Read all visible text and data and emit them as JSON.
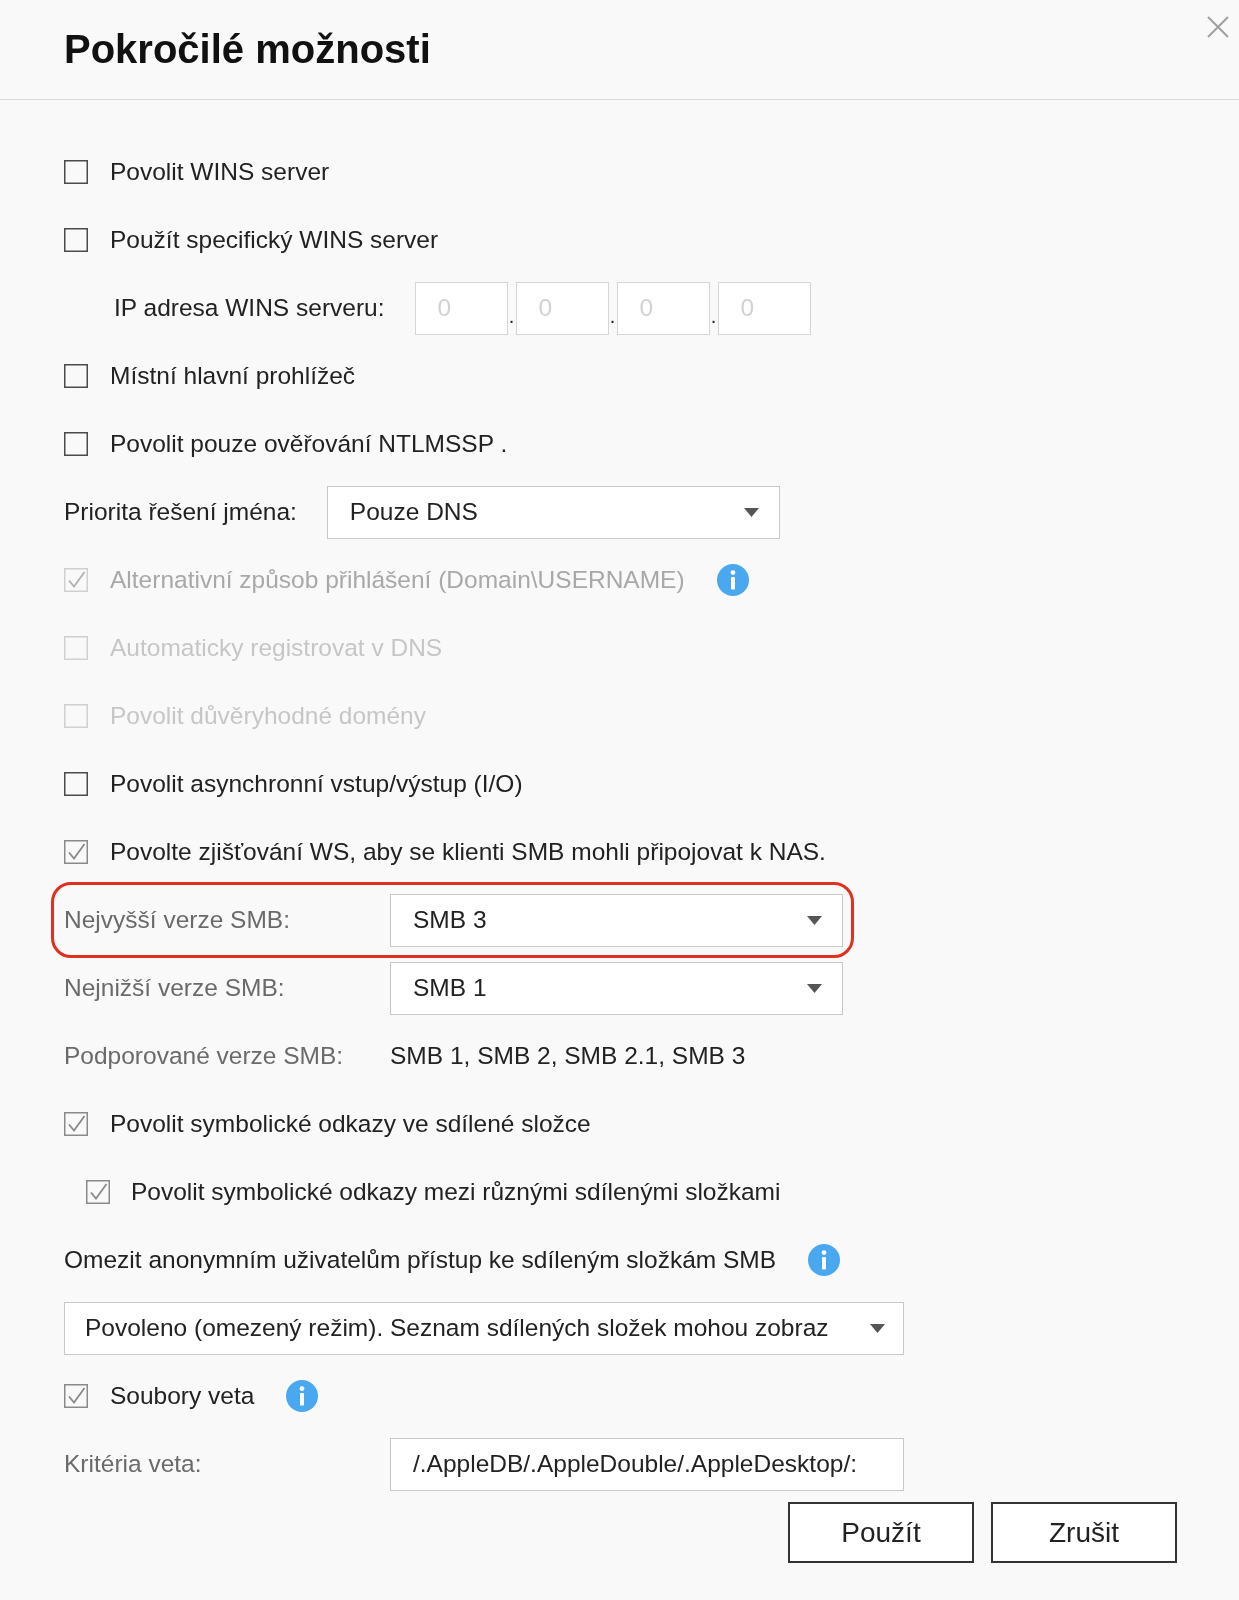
{
  "dialog": {
    "title": "Pokročilé možnosti"
  },
  "rows": [
    {
      "kind": "checkbox",
      "label": "Povolit WINS server",
      "checked": false,
      "disabled": false,
      "info": false
    },
    {
      "kind": "checkbox",
      "label": "Použít specifický WINS server",
      "checked": false,
      "disabled": false,
      "info": false
    },
    {
      "kind": "ip",
      "label": "IP adresa WINS serveru:",
      "disabled": true,
      "octets": [
        "0",
        "0",
        "0",
        "0"
      ],
      "separators": [
        ".",
        ".",
        "."
      ]
    },
    {
      "kind": "checkbox",
      "label": "Místní hlavní prohlížeč",
      "checked": false,
      "disabled": false,
      "info": false
    },
    {
      "kind": "checkbox",
      "label": "Povolit pouze ověřování NTLMSSP .",
      "checked": false,
      "disabled": false,
      "info": false
    },
    {
      "kind": "select",
      "label": "Priorita řešení jména:",
      "value": "Pouze DNS"
    },
    {
      "kind": "checkbox",
      "label": "Alternativní způsob přihlášení (Domain\\USERNAME)",
      "checked": true,
      "disabled": true,
      "info": true
    },
    {
      "kind": "checkbox",
      "label": "Automaticky registrovat v DNS",
      "checked": false,
      "disabled": true,
      "info": false
    },
    {
      "kind": "checkbox",
      "label": "Povolit důvěryhodné domény",
      "checked": false,
      "disabled": true,
      "info": false
    },
    {
      "kind": "checkbox",
      "label": "Povolit asynchronní vstup/výstup (I/O)",
      "checked": false,
      "disabled": false,
      "info": false
    },
    {
      "kind": "checkbox",
      "label": "Povolte zjišťování WS, aby se klienti SMB mohli připojovat k NAS.",
      "checked": true,
      "disabled": false,
      "info": false
    },
    {
      "kind": "form_select",
      "label": "Nejvyšší verze SMB:",
      "value": "SMB 3",
      "highlighted": true
    },
    {
      "kind": "form_select",
      "label": "Nejnižší verze SMB:",
      "value": "SMB 1",
      "highlighted": false
    },
    {
      "kind": "form_text",
      "label": "Podporované verze SMB:",
      "value": "SMB 1, SMB 2, SMB 2.1, SMB 3"
    },
    {
      "kind": "checkbox",
      "label": "Povolit symbolické odkazy ve sdílené složce",
      "checked": true,
      "disabled": false,
      "info": false,
      "children": [
        {
          "kind": "checkbox",
          "label": "Povolit symbolické odkazy mezi různými sdílenými složkami",
          "checked": true,
          "disabled": false,
          "info": false
        }
      ]
    },
    {
      "kind": "text",
      "label": "Omezit anonymním uživatelům přístup ke sdíleným složkám SMB",
      "info": true
    },
    {
      "kind": "wide_select",
      "value": "Povoleno (omezený režim). Seznam sdílených složek mohou zobraz"
    },
    {
      "kind": "checkbox",
      "label": "Soubory veta",
      "checked": true,
      "disabled": false,
      "info": true
    },
    {
      "kind": "form_input",
      "label": "Kritéria veta:",
      "value": "/.AppleDB/.AppleDouble/.AppleDesktop/:"
    }
  ],
  "buttons": [
    {
      "label": "Použít"
    },
    {
      "label": "Zrušit"
    }
  ]
}
